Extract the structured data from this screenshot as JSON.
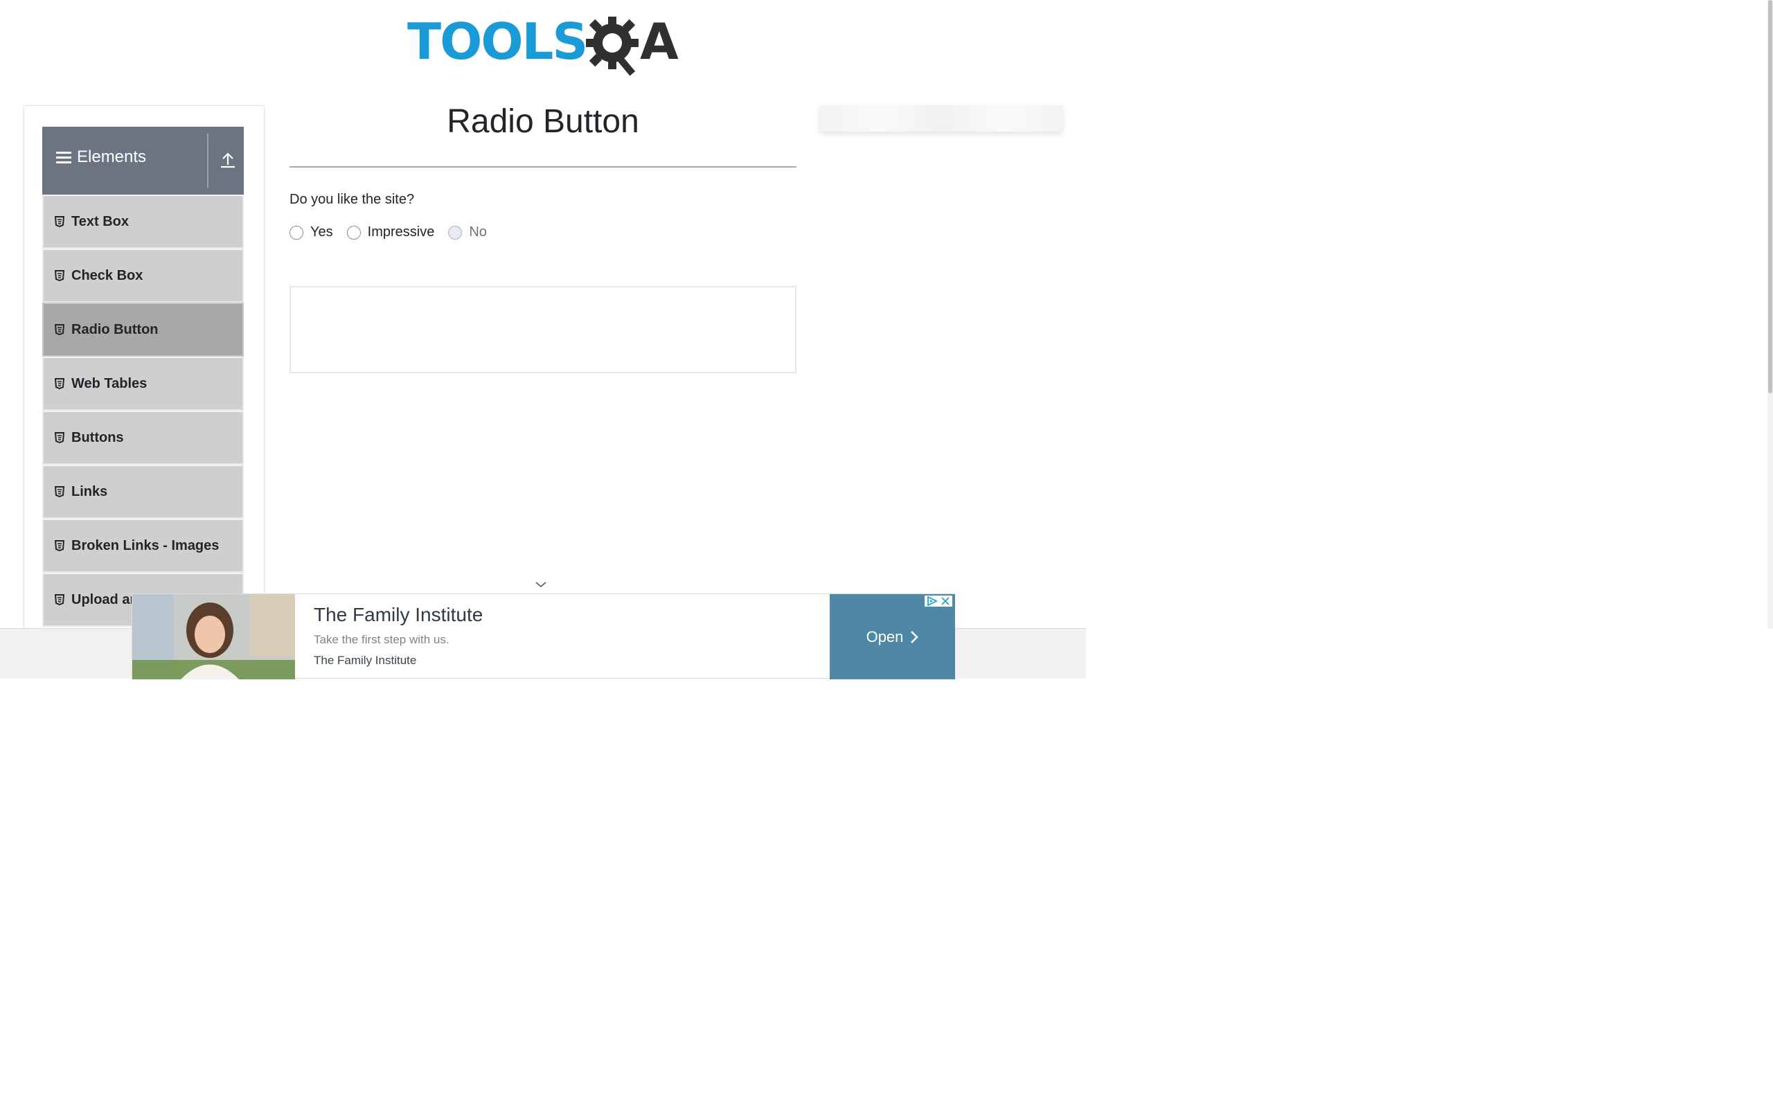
{
  "header": {
    "logo_tools": "TOOLS",
    "logo_qa_suffix": "A"
  },
  "sidebar": {
    "group_title": "Elements",
    "items": [
      {
        "label": "Text Box"
      },
      {
        "label": "Check Box"
      },
      {
        "label": "Radio Button",
        "active": true
      },
      {
        "label": "Web Tables"
      },
      {
        "label": "Buttons"
      },
      {
        "label": "Links"
      },
      {
        "label": "Broken Links - Images"
      },
      {
        "label": "Upload and Download"
      }
    ]
  },
  "main": {
    "title": "Radio Button",
    "question": "Do you like the site?",
    "options": [
      {
        "label": "Yes",
        "disabled": false
      },
      {
        "label": "Impressive",
        "disabled": false
      },
      {
        "label": "No",
        "disabled": true
      }
    ]
  },
  "ad": {
    "title": "The Family Institute",
    "subtitle": "Take the first step with us.",
    "brand": "The Family Institute",
    "cta": "Open"
  },
  "colors": {
    "brand_blue": "#1a9ad6",
    "sidebar_header": "#6b7480",
    "menu_item": "#cfcfcf",
    "menu_item_active": "#a8a8a8",
    "ad_cta": "#4e88a5"
  },
  "icons": {
    "menu": "hamburger-icon",
    "collapse": "collapse-up-icon",
    "item": "html5-icon",
    "ad_close": "close-icon",
    "ad_choices": "adchoices-icon",
    "ad_open": "chevron-right-icon"
  }
}
